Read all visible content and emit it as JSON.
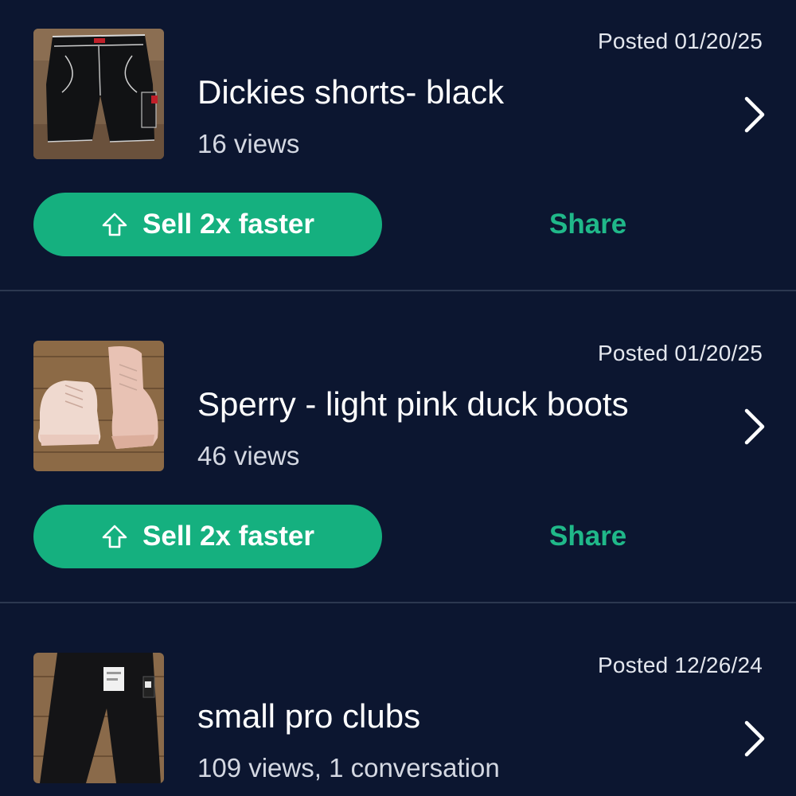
{
  "listings": [
    {
      "posted": "Posted 01/20/25",
      "title": "Dickies shorts- black",
      "stats": "16 views",
      "thumb_icon": "black-shorts-photo",
      "sell_label": "Sell 2x faster",
      "share_label": "Share"
    },
    {
      "posted": "Posted 01/20/25",
      "title": "Sperry - light pink duck boots",
      "stats": "46 views",
      "thumb_icon": "pink-boots-photo",
      "sell_label": "Sell 2x faster",
      "share_label": "Share"
    },
    {
      "posted": "Posted 12/26/24",
      "title": "small pro clubs",
      "stats": "109 views, 1 conversation",
      "thumb_icon": "black-pants-photo"
    }
  ],
  "icons": {
    "chevron": "chevron-right-icon",
    "boost": "arrow-up-outline-icon"
  },
  "colors": {
    "background": "#0c1630",
    "accent": "#15b07f",
    "share_text": "#20b889",
    "divider": "#2c3850"
  }
}
